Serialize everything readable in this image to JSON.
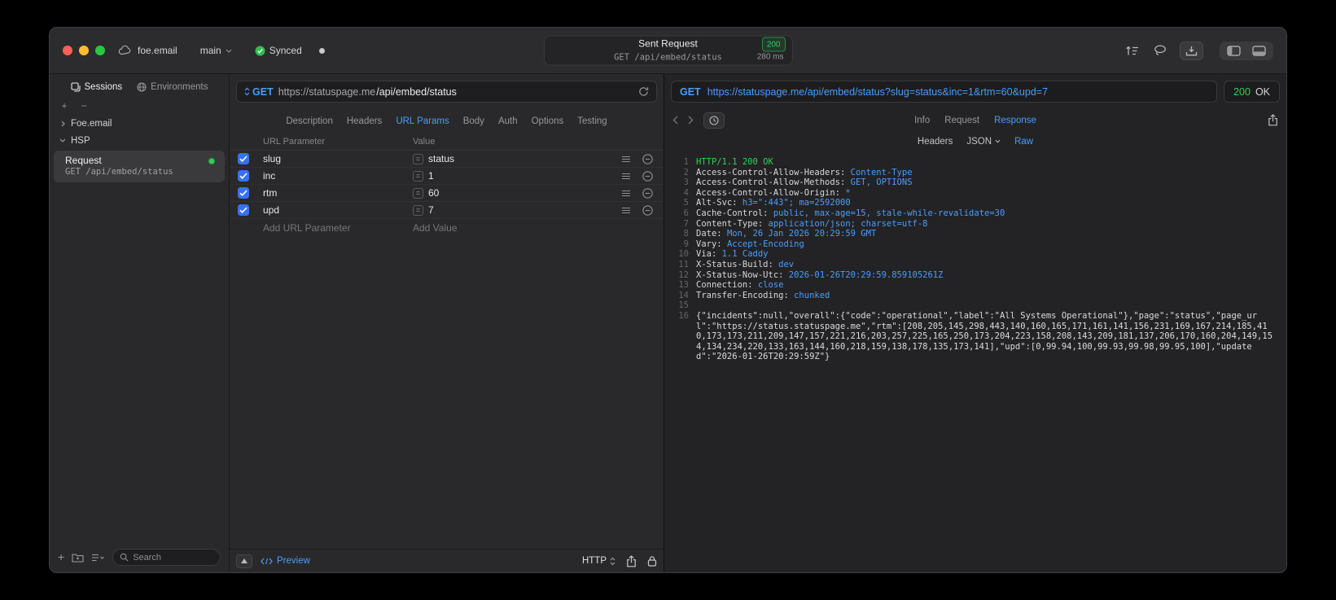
{
  "titlebar": {
    "project_name": "foe.email",
    "branch_name": "main",
    "sync_label": "Synced",
    "request_summary": {
      "title": "Sent Request",
      "status_badge": "200",
      "method_path": "GET /api/embed/status",
      "duration": "280 ms"
    }
  },
  "sidebar": {
    "tabs": {
      "sessions": "Sessions",
      "environments": "Environments"
    },
    "tree": {
      "group1": "Foe.email",
      "group2": "HSP",
      "request_item": {
        "title": "Request",
        "subtitle": "GET /api/embed/status"
      }
    },
    "search_placeholder": "Search"
  },
  "request_editor": {
    "method": "GET",
    "url_host": "https://statuspage.me",
    "url_path": "/api/embed/status",
    "tabs": [
      "Description",
      "Headers",
      "URL Params",
      "Body",
      "Auth",
      "Options",
      "Testing"
    ],
    "active_tab": "URL Params",
    "params": {
      "header_key": "URL Parameter",
      "header_value": "Value",
      "rows": [
        {
          "key": "slug",
          "value": "status"
        },
        {
          "key": "inc",
          "value": "1"
        },
        {
          "key": "rtm",
          "value": "60"
        },
        {
          "key": "upd",
          "value": "7"
        }
      ],
      "add_key": "Add URL Parameter",
      "add_value": "Add Value"
    },
    "footer": {
      "preview": "Preview",
      "protocol": "HTTP"
    }
  },
  "response_viewer": {
    "method": "GET",
    "url": "https://statuspage.me/api/embed/status?slug=status&inc=1&rtm=60&upd=7",
    "status_code": "200",
    "status_text": "OK",
    "tabs": [
      "Info",
      "Request",
      "Response"
    ],
    "active_tab": "Response",
    "subtabs": {
      "headers": "Headers",
      "json": "JSON",
      "raw": "Raw"
    },
    "active_subtab": "Raw",
    "lines": [
      {
        "num": "1",
        "status": "HTTP/1.1 200 OK"
      },
      {
        "num": "2",
        "name": "Access-Control-Allow-Headers: ",
        "value": "Content-Type"
      },
      {
        "num": "3",
        "name": "Access-Control-Allow-Methods: ",
        "value": "GET, OPTIONS"
      },
      {
        "num": "4",
        "name": "Access-Control-Allow-Origin: ",
        "value": "*"
      },
      {
        "num": "5",
        "name": "Alt-Svc: ",
        "value": "h3=\":443\"; ma=2592000"
      },
      {
        "num": "6",
        "name": "Cache-Control: ",
        "value": "public, max-age=15, stale-while-revalidate=30"
      },
      {
        "num": "7",
        "name": "Content-Type: ",
        "value": "application/json; charset=utf-8"
      },
      {
        "num": "8",
        "name": "Date: ",
        "value": "Mon, 26 Jan 2026 20:29:59 GMT"
      },
      {
        "num": "9",
        "name": "Vary: ",
        "value": "Accept-Encoding"
      },
      {
        "num": "10",
        "name": "Via: ",
        "value": "1.1 Caddy"
      },
      {
        "num": "11",
        "name": "X-Status-Build: ",
        "value": "dev"
      },
      {
        "num": "12",
        "name": "X-Status-Now-Utc: ",
        "value": "2026-01-26T20:29:59.859105261Z"
      },
      {
        "num": "13",
        "name": "Connection: ",
        "value": "close"
      },
      {
        "num": "14",
        "name": "Transfer-Encoding: ",
        "value": "chunked"
      },
      {
        "num": "15"
      },
      {
        "num": "16",
        "body": "{\"incidents\":null,\"overall\":{\"code\":\"operational\",\"label\":\"All Systems Operational\"},\"page\":\"status\",\"page_url\":\"https://status.statuspage.me\",\"rtm\":[208,205,145,298,443,140,160,165,171,161,141,156,231,169,167,214,185,410,173,173,211,209,147,157,221,216,203,257,225,165,250,173,204,223,158,208,143,209,181,137,206,170,160,204,149,154,134,234,220,133,163,144,160,218,159,138,178,135,173,141],\"upd\":[0,99.94,100,99.93,99.98,99.95,100],\"updated\":\"2026-01-26T20:29:59Z\"}"
      }
    ]
  },
  "colors": {
    "accent_blue": "#4b9df8",
    "green": "#30d158"
  }
}
